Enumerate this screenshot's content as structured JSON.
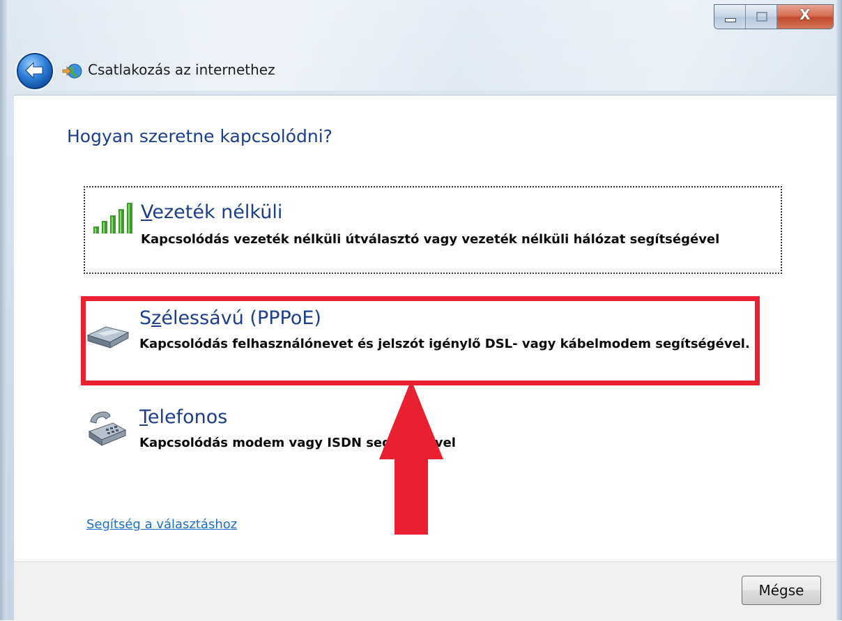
{
  "window": {
    "title": "Csatlakozás az internethez",
    "close_symbol": "X"
  },
  "main": {
    "heading": "Hogyan szeretne kapcsolódni?",
    "options": [
      {
        "title_accel": "V",
        "title_rest": "ezeték nélküli",
        "description": "Kapcsolódás vezeték nélküli útválasztó vagy vezeték nélküli hálózat segítségével",
        "icon": "wireless-signal-icon"
      },
      {
        "title_prefix": "S",
        "title_accel": "z",
        "title_rest": "élessávú (PPPoE)",
        "description": "Kapcsolódás felhasználónevet és jelszót igénylő DSL- vagy kábelmodem segítségével.",
        "icon": "broadband-modem-icon"
      },
      {
        "title_accel": "T",
        "title_rest": "elefonos",
        "description": "Kapcsolódás modem vagy ISDN segítségével",
        "icon": "telephone-icon"
      }
    ],
    "help_link": "Segítség a választáshoz"
  },
  "footer": {
    "cancel_label": "Mégse"
  },
  "annotation": {
    "highlight_color": "#e8202f",
    "arrow_color": "#e8202f"
  }
}
